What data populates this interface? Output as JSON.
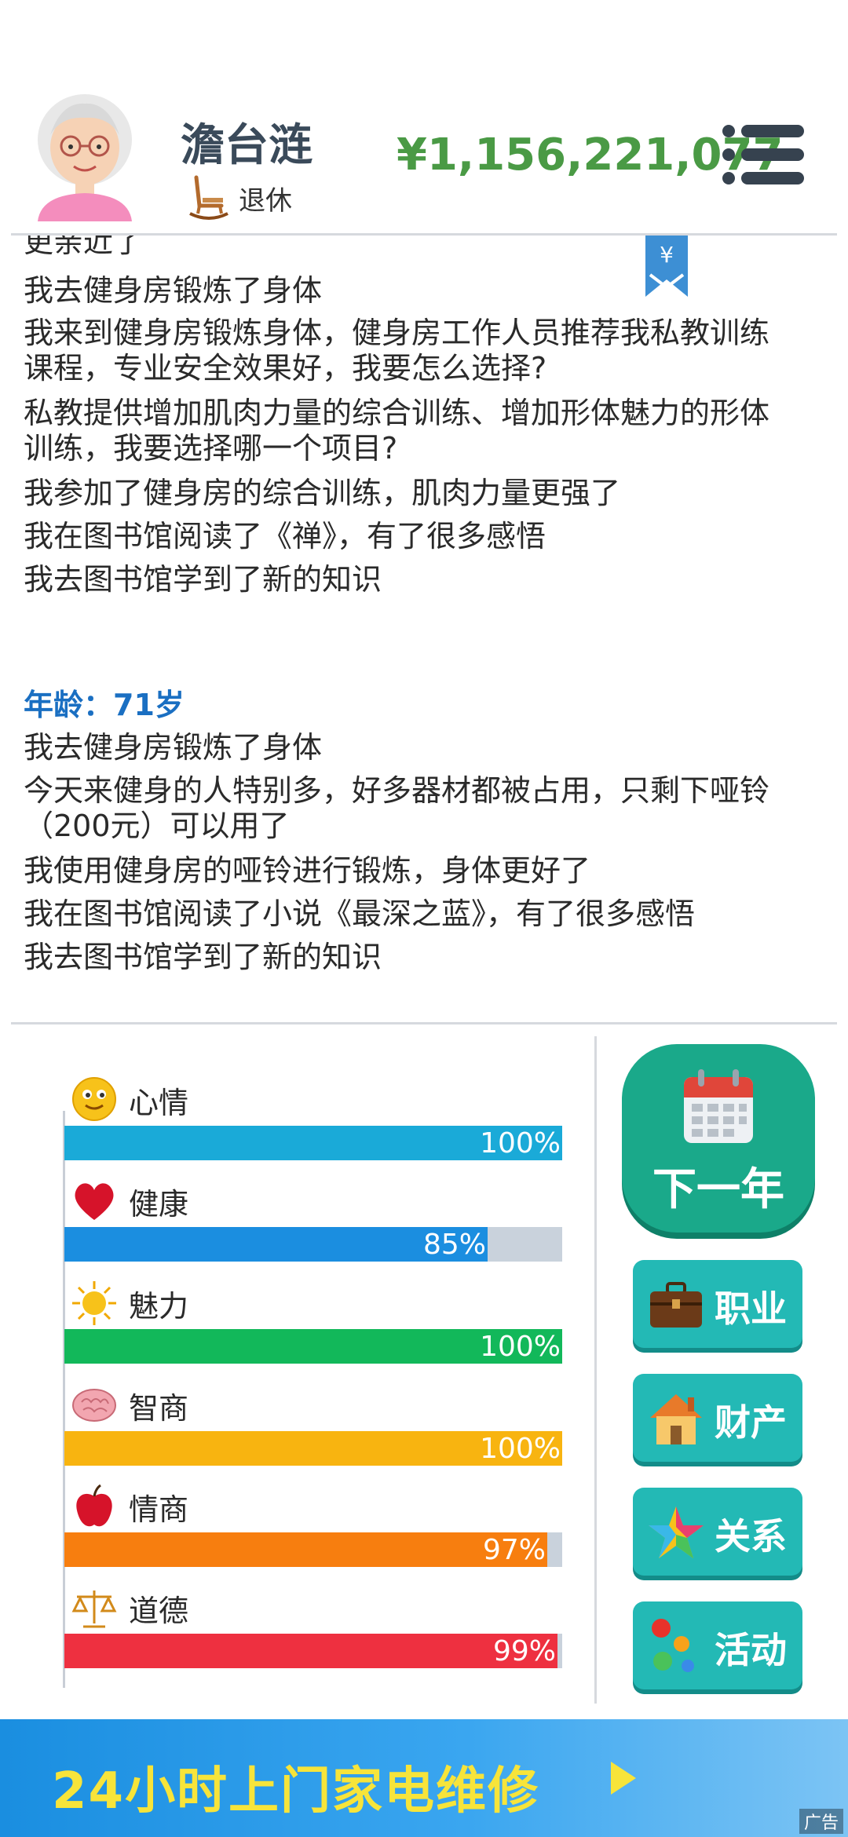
{
  "header": {
    "name": "澹台涟",
    "status": "退休",
    "money": "¥1,156,221,077"
  },
  "log": {
    "partial_top": "更亲近了",
    "block1": [
      "我去健身房锻炼了身体",
      "我来到健身房锻炼身体，健身房工作人员推荐我私教训练",
      "课程，专业安全效果好，我要怎么选择?",
      "私教提供增加肌肉力量的综合训练、增加形体魅力的形体",
      "训练，我要选择哪一个项目?",
      "我参加了健身房的综合训练，肌肉力量更强了",
      "我在图书馆阅读了《禅》，有了很多感悟",
      "我去图书馆学到了新的知识"
    ],
    "age_label": "年龄：71岁",
    "block2": [
      "我去健身房锻炼了身体",
      "今天来健身的人特别多，好多器材都被占用，只剩下哑铃",
      "（200元）可以用了",
      "我使用健身房的哑铃进行锻炼，身体更好了",
      "我在图书馆阅读了小说《最深之蓝》，有了很多感悟",
      "我去图书馆学到了新的知识"
    ],
    "bookmark_symbol": "¥"
  },
  "stats": [
    {
      "label": "心情",
      "icon": "smiley-icon",
      "value": 100,
      "pct": "100%",
      "color": "#1aaad8"
    },
    {
      "label": "健康",
      "icon": "heart-icon",
      "value": 85,
      "pct": "85%",
      "color": "#1b8ee0"
    },
    {
      "label": "魅力",
      "icon": "sun-icon",
      "value": 100,
      "pct": "100%",
      "color": "#12b85a"
    },
    {
      "label": "智商",
      "icon": "brain-icon",
      "value": 100,
      "pct": "100%",
      "color": "#f8b410"
    },
    {
      "label": "情商",
      "icon": "apple-icon",
      "value": 97,
      "pct": "97%",
      "color": "#f77e0f"
    },
    {
      "label": "道德",
      "icon": "scales-icon",
      "value": 99,
      "pct": "99%",
      "color": "#ee3040"
    }
  ],
  "buttons": {
    "next_year": "下一年",
    "career": "职业",
    "property": "财产",
    "relations": "关系",
    "activities": "活动"
  },
  "ad": {
    "text": "24小时上门家电维修",
    "tag": "广告"
  },
  "colors": {
    "money": "#4a9a45",
    "age_label": "#1a6fc2",
    "next_year_bg": "#1aa98a",
    "side_button_bg": "#23b9b5"
  }
}
